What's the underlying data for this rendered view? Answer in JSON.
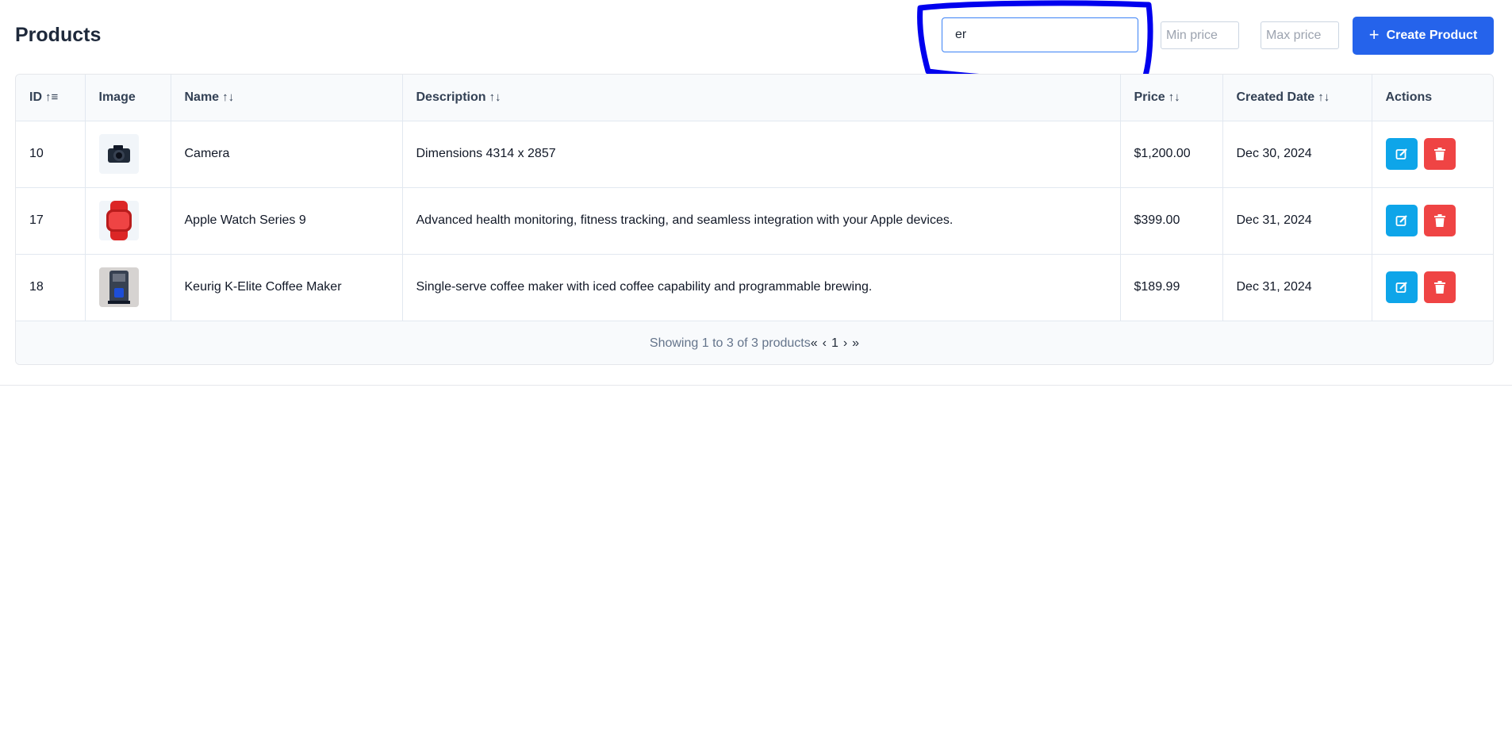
{
  "page": {
    "title": "Products"
  },
  "filters": {
    "search_value": "er",
    "min_price_placeholder": "Min price",
    "max_price_placeholder": "Max price",
    "create_label": "Create Product"
  },
  "table": {
    "columns": [
      {
        "label": "ID",
        "sort_glyph": "↑≡"
      },
      {
        "label": "Image",
        "sort_glyph": ""
      },
      {
        "label": "Name",
        "sort_glyph": "↑↓"
      },
      {
        "label": "Description",
        "sort_glyph": "↑↓"
      },
      {
        "label": "Price",
        "sort_glyph": "↑↓"
      },
      {
        "label": "Created Date",
        "sort_glyph": "↑↓"
      },
      {
        "label": "Actions",
        "sort_glyph": ""
      }
    ],
    "rows": [
      {
        "id": "10",
        "image_icon": "camera-icon",
        "name": "Camera",
        "description": "Dimensions 4314 x 2857",
        "price": "$1,200.00",
        "created": "Dec 30, 2024"
      },
      {
        "id": "17",
        "image_icon": "smartwatch-icon",
        "name": "Apple Watch Series 9",
        "description": "Advanced health monitoring, fitness tracking, and seamless integration with your Apple devices.",
        "price": "$399.00",
        "created": "Dec 31, 2024"
      },
      {
        "id": "18",
        "image_icon": "coffee-maker-icon",
        "name": "Keurig K-Elite Coffee Maker",
        "description": "Single-serve coffee maker with iced coffee capability and programmable brewing.",
        "price": "$189.99",
        "created": "Dec 31, 2024"
      }
    ]
  },
  "footer": {
    "summary": "Showing 1 to 3 of 3 products",
    "first": "«",
    "prev": "‹",
    "page": "1",
    "next": "›",
    "last": "»"
  },
  "colors": {
    "primary": "#2563eb",
    "edit": "#0ea5e9",
    "delete": "#ef4444",
    "annotation": "#0000ee"
  }
}
